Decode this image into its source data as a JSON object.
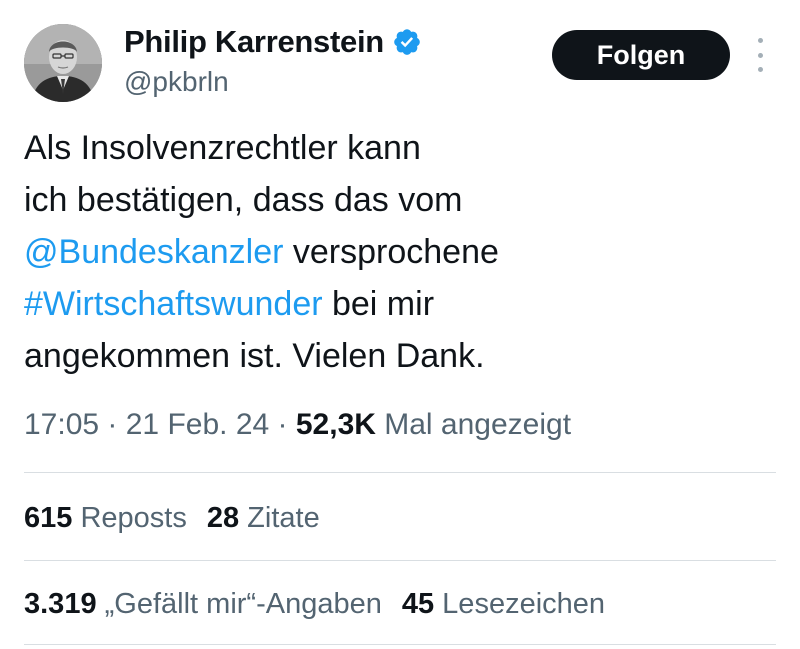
{
  "user": {
    "display_name": "Philip Karrenstein",
    "handle": "@pkbrln",
    "verified": true
  },
  "header": {
    "follow_label": "Folgen"
  },
  "tweet": {
    "line1": "Als Insolvenzrechtler kann",
    "line2": "ich bestätigen, dass das vom",
    "mention": "@Bundeskanzler",
    "line3_rest": " versprochene",
    "hashtag": "#Wirtschaftswunder",
    "line4_rest": " bei mir",
    "line5": "angekommen ist. Vielen Dank."
  },
  "meta": {
    "time": "17:05",
    "separator": " · ",
    "date": "21 Feb. 24",
    "views_count": "52,3K",
    "views_label": " Mal angezeigt"
  },
  "stats": {
    "reposts_count": "615",
    "reposts_label": " Reposts",
    "quotes_count": "28",
    "quotes_label": " Zitate",
    "likes_count": "3.319",
    "likes_label": " „Gefällt mir“-Angaben",
    "bookmarks_count": "45",
    "bookmarks_label": " Lesezeichen"
  },
  "colors": {
    "link": "#1d9bf0",
    "text": "#0f1419",
    "secondary": "#536471",
    "verified_badge": "#1d9bf0",
    "button_bg": "#0f1419"
  },
  "icons": {
    "verified": "verified-badge-icon",
    "more": "more-vertical-icon"
  }
}
